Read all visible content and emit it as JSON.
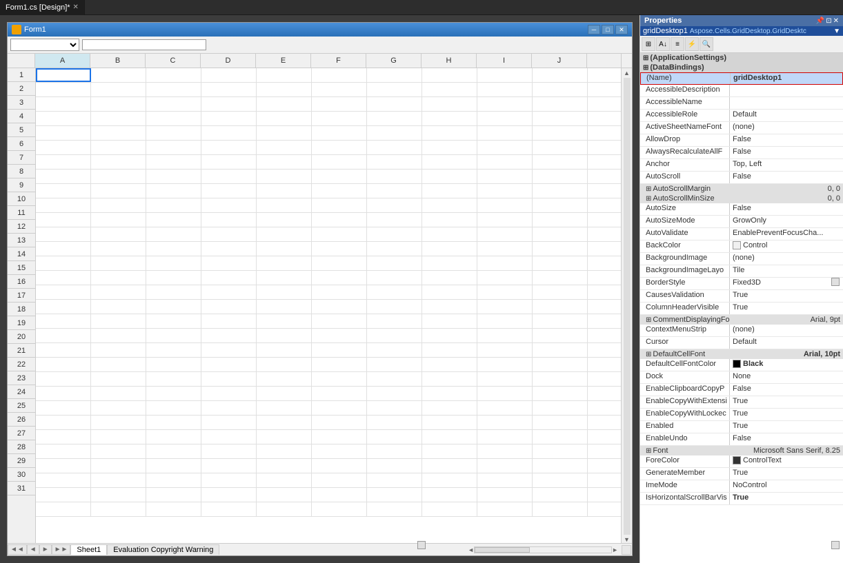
{
  "tabBar": {
    "tabs": [
      {
        "id": "form1",
        "label": "Form1.cs [Design]*",
        "active": true
      }
    ]
  },
  "formWindow": {
    "title": "Form1",
    "icon": "form-icon",
    "buttons": [
      "minimize",
      "maximize",
      "close"
    ]
  },
  "toolbar": {
    "dropdown": {
      "value": "",
      "placeholder": ""
    },
    "input": {
      "value": "",
      "placeholder": ""
    }
  },
  "grid": {
    "columns": [
      "A",
      "B",
      "C",
      "D",
      "E",
      "F",
      "G",
      "H",
      "I",
      "J"
    ],
    "rows": [
      1,
      2,
      3,
      4,
      5,
      6,
      7,
      8,
      9,
      10,
      11,
      12,
      13,
      14,
      15,
      16,
      17,
      18,
      19,
      20,
      21,
      22,
      23,
      24,
      25,
      26,
      27,
      28,
      29,
      30,
      31
    ]
  },
  "sheetTabs": {
    "nav": [
      "◄◄",
      "◄",
      "►",
      "►►"
    ],
    "tabs": [
      {
        "label": "Sheet1",
        "active": true
      },
      {
        "label": "Evaluation Copyright Warning",
        "active": false
      }
    ]
  },
  "properties": {
    "header": {
      "title": "Properties",
      "controls": [
        "pin",
        "float",
        "close"
      ]
    },
    "objectName": "gridDesktop1",
    "objectType": "Aspose.Cells.GridDesktop.GridDesktc",
    "toolbar": [
      {
        "icon": "categorized-icon",
        "label": "⊞"
      },
      {
        "icon": "alphabetical-icon",
        "label": "A↓"
      },
      {
        "icon": "properties-icon",
        "label": "≡"
      },
      {
        "icon": "events-icon",
        "label": "⚡"
      },
      {
        "icon": "search-icon",
        "label": "🔍"
      }
    ],
    "sections": [
      {
        "label": "(ApplicationSettings)",
        "expanded": false,
        "rows": []
      },
      {
        "label": "(DataBindings)",
        "expanded": false,
        "rows": []
      }
    ],
    "rows": [
      {
        "name": "(Name)",
        "value": "gridDesktop1",
        "highlighted": true,
        "bold": false
      },
      {
        "name": "AccessibleDescription",
        "value": "",
        "highlighted": false
      },
      {
        "name": "AccessibleName",
        "value": "",
        "highlighted": false
      },
      {
        "name": "AccessibleRole",
        "value": "Default",
        "highlighted": false
      },
      {
        "name": "ActiveSheetNameFont",
        "value": "(none)",
        "highlighted": false
      },
      {
        "name": "AllowDrop",
        "value": "False",
        "highlighted": false
      },
      {
        "name": "AlwaysRecalculateAllF",
        "value": "False",
        "highlighted": false
      },
      {
        "name": "Anchor",
        "value": "Top, Left",
        "highlighted": false
      },
      {
        "name": "AutoScroll",
        "value": "False",
        "highlighted": false
      },
      {
        "name": "AutoScrollMargin",
        "value": "0, 0",
        "highlighted": false,
        "section": true
      },
      {
        "name": "AutoScrollMinSize",
        "value": "0, 0",
        "highlighted": false,
        "section": true
      },
      {
        "name": "AutoSize",
        "value": "False",
        "highlighted": false
      },
      {
        "name": "AutoSizeMode",
        "value": "GrowOnly",
        "highlighted": false
      },
      {
        "name": "AutoValidate",
        "value": "EnablePreventFocusChar",
        "highlighted": false
      },
      {
        "name": "BackColor",
        "value": "Control",
        "highlighted": false,
        "hasColor": true,
        "colorHex": "#f0f0f0"
      },
      {
        "name": "BackgroundImage",
        "value": "(none)",
        "highlighted": false
      },
      {
        "name": "BackgroundImageLayo",
        "value": "Tile",
        "highlighted": false
      },
      {
        "name": "BorderStyle",
        "value": "Fixed3D",
        "highlighted": false
      },
      {
        "name": "CausesValidation",
        "value": "True",
        "highlighted": false
      },
      {
        "name": "ColumnHeaderVisible",
        "value": "True",
        "highlighted": false
      },
      {
        "name": "CommentDisplayingFo",
        "value": "Arial, 9pt",
        "highlighted": false,
        "section": true
      },
      {
        "name": "ContextMenuStrip",
        "value": "(none)",
        "highlighted": false
      },
      {
        "name": "Cursor",
        "value": "Default",
        "highlighted": false
      },
      {
        "name": "DefaultCellFont",
        "value": "Arial, 10pt",
        "highlighted": false,
        "bold": true,
        "section": true
      },
      {
        "name": "DefaultCellFontColor",
        "value": "Black",
        "highlighted": false,
        "bold": true,
        "hasColor": true,
        "colorHex": "#000000"
      },
      {
        "name": "Dock",
        "value": "None",
        "highlighted": false
      },
      {
        "name": "EnableClipboardCopyP",
        "value": "False",
        "highlighted": false
      },
      {
        "name": "EnableCopyWithExtensi",
        "value": "True",
        "highlighted": false
      },
      {
        "name": "EnableCopyWithLockec",
        "value": "True",
        "highlighted": false
      },
      {
        "name": "Enabled",
        "value": "True",
        "highlighted": false
      },
      {
        "name": "EnableUndo",
        "value": "False",
        "highlighted": false
      },
      {
        "name": "Font",
        "value": "Microsoft Sans Serif, 8.25",
        "highlighted": false,
        "section": true
      },
      {
        "name": "ForeColor",
        "value": "ControlText",
        "highlighted": false,
        "hasColor": true,
        "colorHex": "#222222"
      },
      {
        "name": "GenerateMember",
        "value": "True",
        "highlighted": false
      },
      {
        "name": "ImeMode",
        "value": "NoControl",
        "highlighted": false
      },
      {
        "name": "IsHorizontalScrollBarVis",
        "value": "True",
        "highlighted": false,
        "bold": true
      }
    ]
  }
}
